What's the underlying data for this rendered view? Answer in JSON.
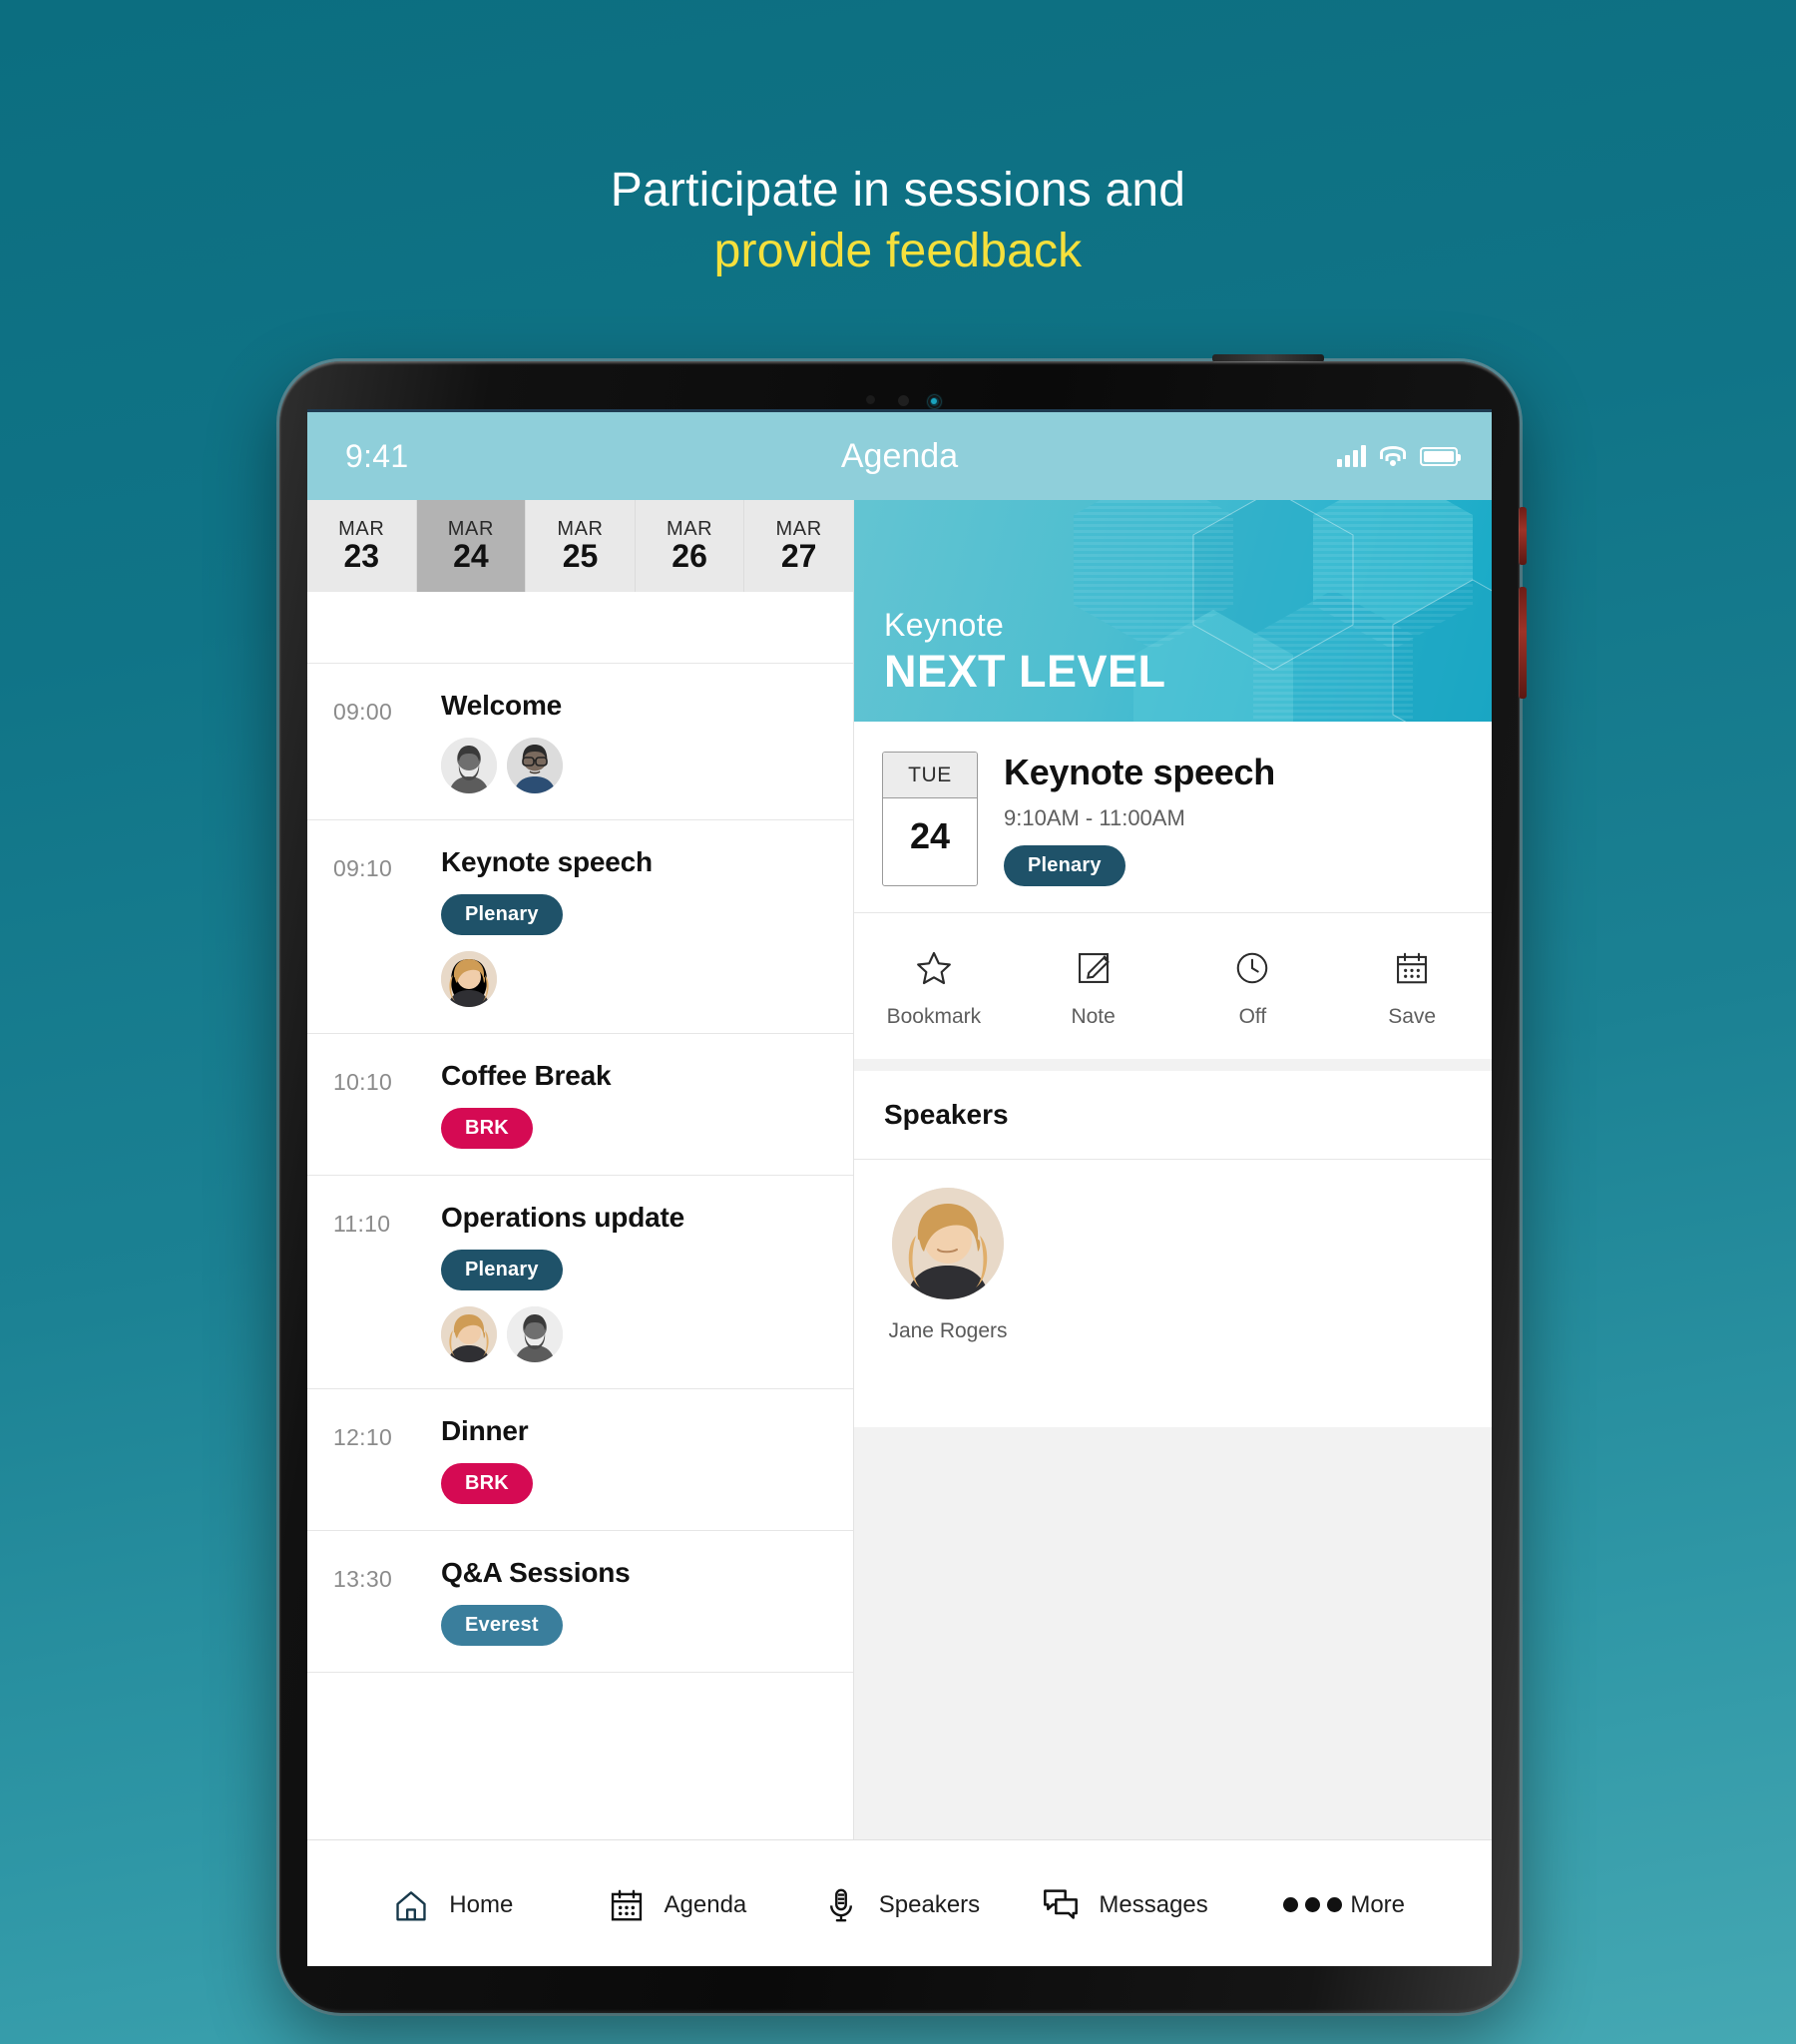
{
  "promo": {
    "line1": "Participate in sessions and",
    "line2": "provide feedback",
    "line1_color": "#ffffff",
    "line2_color": "#f5e03c",
    "background_color": "#107487"
  },
  "status_bar": {
    "time": "9:41",
    "title": "Agenda",
    "background_color": "#8fcfda",
    "icons": [
      "signal-icon",
      "wifi-icon",
      "battery-icon"
    ]
  },
  "date_tabs": [
    {
      "month": "MAR",
      "day": "23",
      "selected": false
    },
    {
      "month": "MAR",
      "day": "24",
      "selected": true
    },
    {
      "month": "MAR",
      "day": "25",
      "selected": false
    },
    {
      "month": "MAR",
      "day": "26",
      "selected": false
    },
    {
      "month": "MAR",
      "day": "27",
      "selected": false
    }
  ],
  "agenda": [
    {
      "time": "09:00",
      "title": "Welcome",
      "badge": null,
      "badge_type": null,
      "avatars": 2
    },
    {
      "time": "09:10",
      "title": "Keynote speech",
      "badge": "Plenary",
      "badge_type": "plenary",
      "avatars": 1
    },
    {
      "time": "10:10",
      "title": "Coffee Break",
      "badge": "BRK",
      "badge_type": "brk",
      "avatars": 0
    },
    {
      "time": "11:10",
      "title": "Operations update",
      "badge": "Plenary",
      "badge_type": "plenary",
      "avatars": 2
    },
    {
      "time": "12:10",
      "title": "Dinner",
      "badge": "BRK",
      "badge_type": "brk",
      "avatars": 0
    },
    {
      "time": "13:30",
      "title": "Q&A Sessions",
      "badge": "Everest",
      "badge_type": "everest",
      "avatars": 0
    }
  ],
  "badge_colors": {
    "plenary": "#1f5269",
    "brk": "#d50a53",
    "everest": "#3a7e9c"
  },
  "detail": {
    "banner": {
      "eyebrow": "Keynote",
      "title": "NEXT LEVEL",
      "accent_color": "#2fb4cf"
    },
    "calendar_chip": {
      "weekday": "TUE",
      "day": "24"
    },
    "session_title": "Keynote speech",
    "session_time": "9:10AM - 11:00AM",
    "session_badge": "Plenary",
    "actions": [
      {
        "label": "Bookmark",
        "icon": "star-icon"
      },
      {
        "label": "Note",
        "icon": "note-edit-icon"
      },
      {
        "label": "Off",
        "icon": "clock-icon"
      },
      {
        "label": "Save",
        "icon": "calendar-icon"
      }
    ],
    "speakers_heading": "Speakers",
    "speakers": [
      {
        "name": "Jane Rogers"
      }
    ]
  },
  "bottom_nav": [
    {
      "label": "Home",
      "icon": "home-icon"
    },
    {
      "label": "Agenda",
      "icon": "calendar-icon"
    },
    {
      "label": "Speakers",
      "icon": "microphone-icon"
    },
    {
      "label": "Messages",
      "icon": "chat-icon"
    },
    {
      "label": "More",
      "icon": "ellipsis-icon"
    }
  ]
}
